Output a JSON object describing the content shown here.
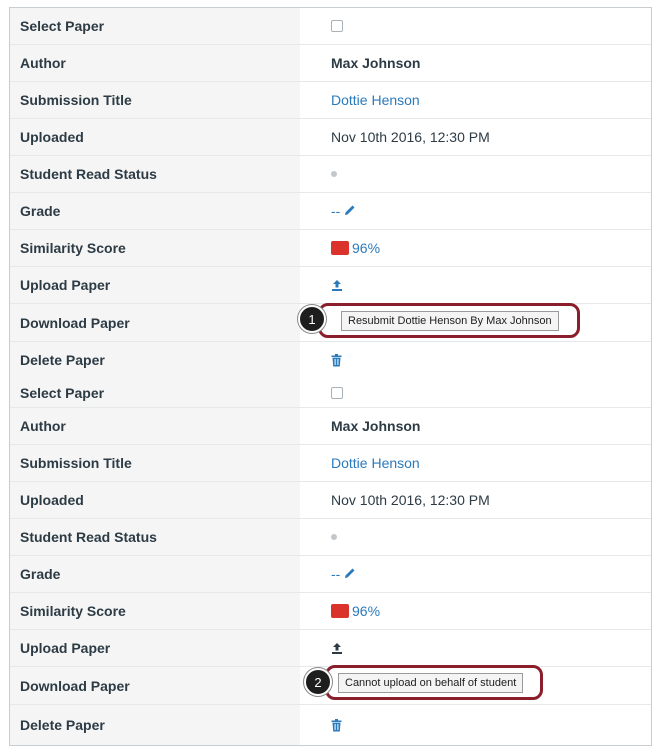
{
  "records": [
    {
      "select_label": "Select Paper",
      "author_label": "Author",
      "author_value": "Max Johnson",
      "title_label": "Submission Title",
      "title_value": "Dottie Henson",
      "uploaded_label": "Uploaded",
      "uploaded_value": "Nov 10th 2016, 12:30 PM",
      "read_status_label": "Student Read Status",
      "grade_label": "Grade",
      "grade_value": "--",
      "similarity_label": "Similarity Score",
      "similarity_value": "96%",
      "upload_label": "Upload Paper",
      "download_label": "Download Paper",
      "delete_label": "Delete Paper"
    },
    {
      "select_label": "Select Paper",
      "author_label": "Author",
      "author_value": "Max Johnson",
      "title_label": "Submission Title",
      "title_value": "Dottie Henson",
      "uploaded_label": "Uploaded",
      "uploaded_value": "Nov 10th 2016, 12:30 PM",
      "read_status_label": "Student Read Status",
      "grade_label": "Grade",
      "grade_value": "--",
      "similarity_label": "Similarity Score",
      "similarity_value": "96%",
      "upload_label": "Upload Paper",
      "download_label": "Download Paper",
      "delete_label": "Delete Paper"
    }
  ],
  "callouts": [
    {
      "number": "1",
      "tooltip": "Resubmit Dottie Henson By Max Johnson"
    },
    {
      "number": "2",
      "tooltip": "Cannot upload on behalf of student"
    }
  ],
  "colors": {
    "link": "#2b7abc",
    "similarity_high": "#d9332c",
    "callout_border": "#8a1f2b"
  },
  "icons": {
    "upload": "upload-icon",
    "download": "download-icon",
    "delete": "trash-icon",
    "edit": "pencil-icon"
  }
}
